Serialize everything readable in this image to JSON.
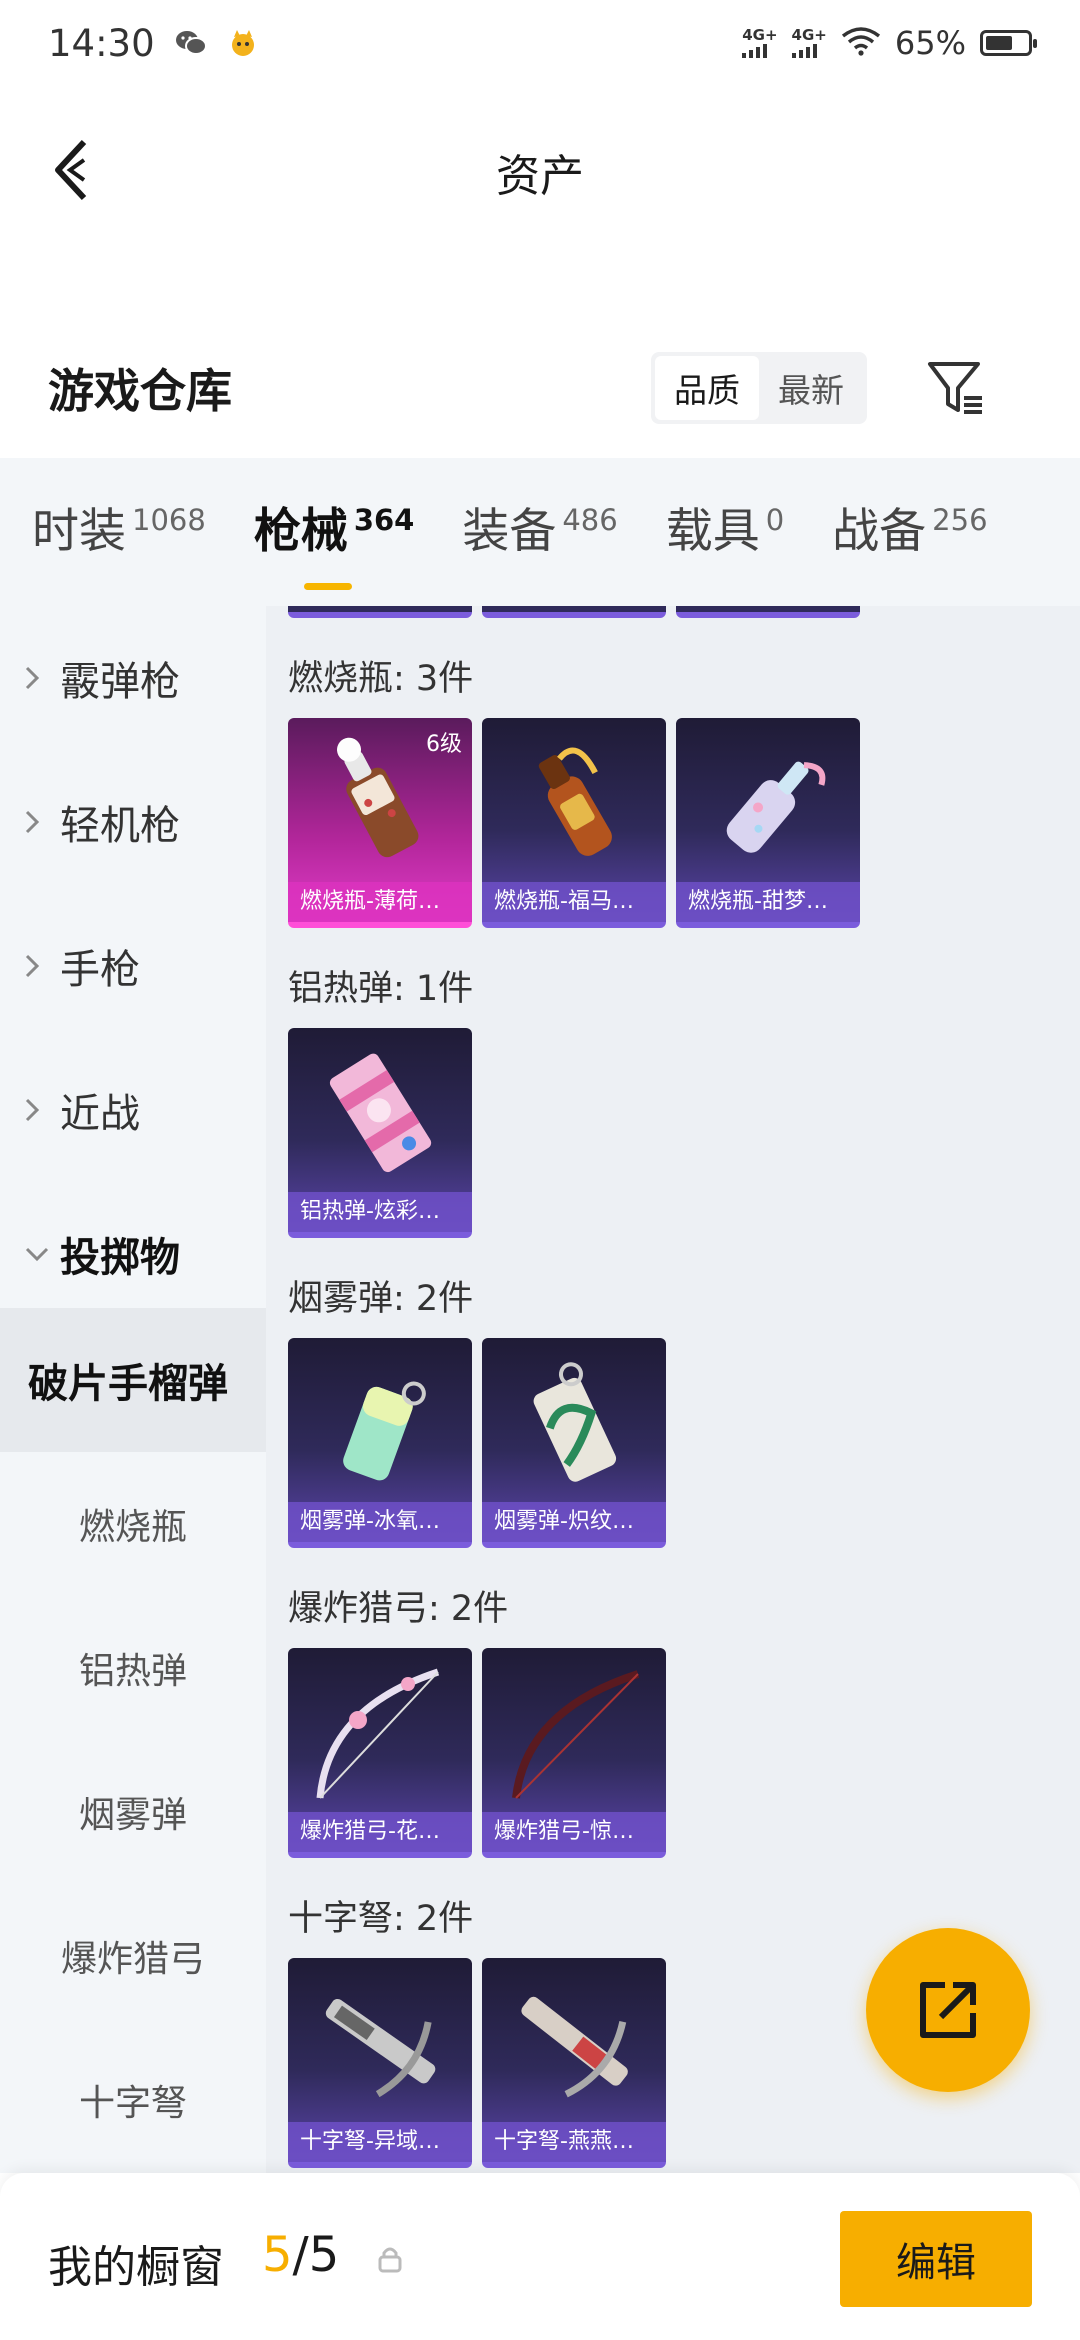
{
  "status_bar": {
    "time": "14:30",
    "network_1": "4G+",
    "network_2": "4G+",
    "battery_pct": "65%",
    "battery_level": 0.65,
    "icons": [
      "wechat-icon",
      "app-mascot-icon",
      "signal-icon",
      "wifi-icon",
      "battery-icon"
    ]
  },
  "header": {
    "title": "资产",
    "back_icon": "chevron-left-icon"
  },
  "section": {
    "title": "游戏仓库",
    "sort_options": [
      "品质",
      "最新"
    ],
    "sort_active": 0,
    "filter_icon": "filter-icon"
  },
  "category_tabs": [
    {
      "label": "时装",
      "count": "1068"
    },
    {
      "label": "枪械",
      "count": "364",
      "active": true
    },
    {
      "label": "装备",
      "count": "486"
    },
    {
      "label": "载具",
      "count": "0"
    },
    {
      "label": "战备",
      "count": "256"
    }
  ],
  "sidebar": {
    "items": [
      {
        "label": "霰弹枪",
        "state": "collapsed"
      },
      {
        "label": "轻机枪",
        "state": "collapsed"
      },
      {
        "label": "手枪",
        "state": "collapsed"
      },
      {
        "label": "近战",
        "state": "collapsed"
      },
      {
        "label": "投掷物",
        "state": "expanded"
      }
    ],
    "selected": "破片手榴弹",
    "sub_items": [
      "燃烧瓶",
      "铝热弹",
      "烟雾弹",
      "爆炸猎弓",
      "十字弩"
    ]
  },
  "groups": [
    {
      "title": "燃烧瓶: 3件",
      "items": [
        {
          "name": "燃烧瓶-薄荷…",
          "level": "6级",
          "rarity": "legendary"
        },
        {
          "name": "燃烧瓶-福马…",
          "rarity": "epic"
        },
        {
          "name": "燃烧瓶-甜梦…",
          "rarity": "epic"
        }
      ]
    },
    {
      "title": "铝热弹: 1件",
      "items": [
        {
          "name": "铝热弹-炫彩…",
          "rarity": "epic"
        }
      ]
    },
    {
      "title": "烟雾弹: 2件",
      "items": [
        {
          "name": "烟雾弹-冰氧…",
          "rarity": "epic"
        },
        {
          "name": "烟雾弹-炽纹…",
          "rarity": "epic"
        }
      ]
    },
    {
      "title": "爆炸猎弓: 2件",
      "items": [
        {
          "name": "爆炸猎弓-花…",
          "rarity": "epic"
        },
        {
          "name": "爆炸猎弓-惊…",
          "rarity": "epic"
        }
      ]
    },
    {
      "title": "十字弩: 2件",
      "items": [
        {
          "name": "十字弩-异域…",
          "rarity": "epic"
        },
        {
          "name": "十字弩-燕燕…",
          "rarity": "epic"
        }
      ]
    }
  ],
  "fab": {
    "icon": "share-external-icon"
  },
  "bottom_bar": {
    "label": "我的橱窗",
    "current": "5",
    "separator": "/",
    "total": "5",
    "lock_icon": "lock-icon",
    "edit_label": "编辑"
  },
  "colors": {
    "accent": "#f7ae00",
    "card_epic": "#5a44a8",
    "card_legendary": "#e03cc7",
    "sidebar_bg": "#f3f6f9",
    "content_bg": "#edf0f4"
  }
}
